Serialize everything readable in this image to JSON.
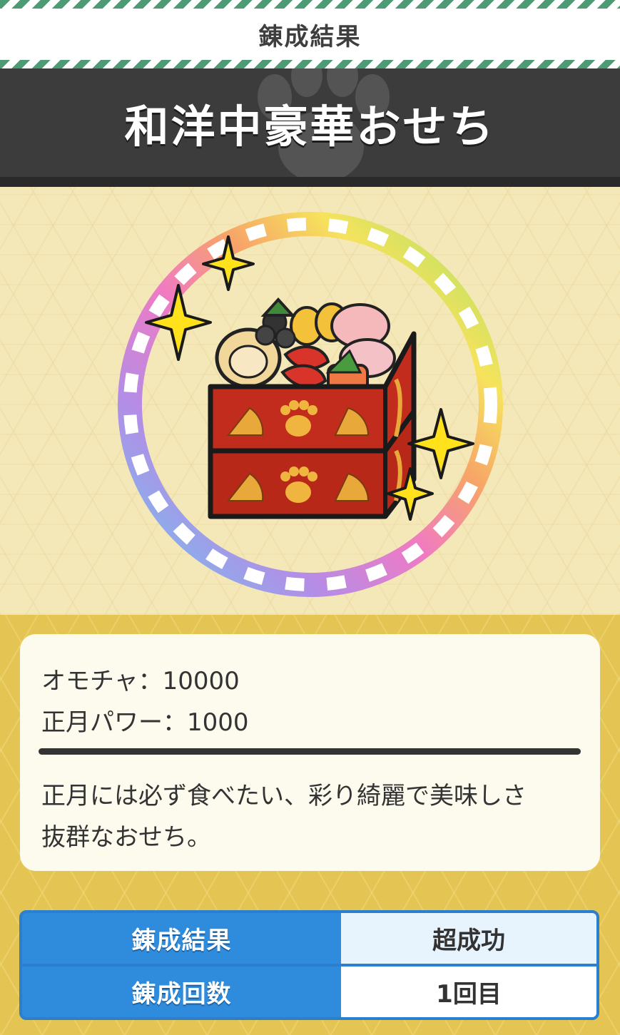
{
  "header": {
    "title": "錬成結果"
  },
  "item": {
    "name": "和洋中豪華おせち"
  },
  "image": {
    "icon": "osechi-box-icon",
    "ring_colors": [
      "#6ec4ef",
      "#b48de6",
      "#f07ac4",
      "#f7a468",
      "#f6e35c",
      "#a8e068",
      "#6ec4ef"
    ],
    "sparkle_color": "#ffe21c"
  },
  "info": {
    "stats": [
      "オモチャ：10000",
      "正月パワー：1000"
    ],
    "description_lines": [
      "正月には必ず食べたい、彩り綺麗で美味しさ",
      "抜群なおせち。"
    ]
  },
  "result_table": {
    "rows": [
      {
        "label": "錬成結果",
        "value": "超成功"
      },
      {
        "label": "錬成回数",
        "value": "1回目"
      }
    ]
  },
  "colors": {
    "header_stripe": "#4d9b74",
    "banner": "#3c3c3c",
    "table_blue": "#2f8bdc"
  }
}
